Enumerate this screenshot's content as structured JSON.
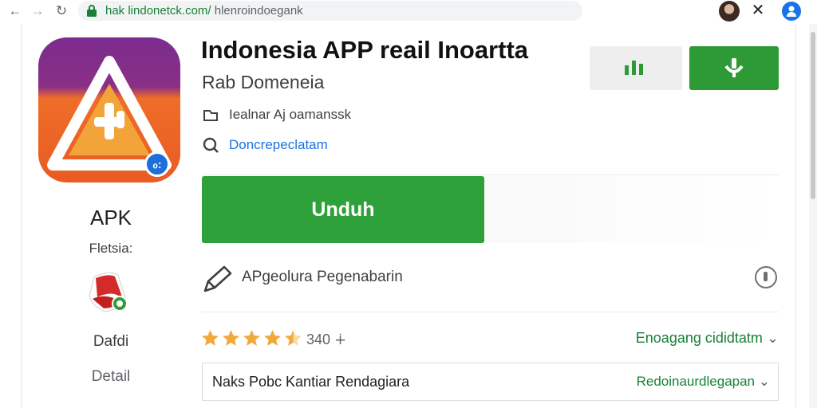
{
  "browser": {
    "back_icon": "arrow-left-icon",
    "forward_icon": "arrow-right-icon",
    "reload_icon": "reload-icon",
    "url_host": "hak lindonetck.com/",
    "url_path": " hlenroindoegank",
    "close_icon": "close-icon",
    "profile_icon": "profile-icon"
  },
  "sidebar": {
    "title": "APK",
    "subtitle": "Fletsia:",
    "link_1": "Dafdi",
    "link_2": "Detail"
  },
  "app": {
    "title": "Indonesia APP reail Inoartta",
    "developer": "Rab Domeneia",
    "meta_1": "Iealnar Aj oamanssk",
    "meta_2": "Doncrepeclatam",
    "badge_text": "ℴ:"
  },
  "actions": {
    "download_label": "Unduh"
  },
  "permissions": {
    "label": "APgeolura Pegenabarin"
  },
  "rating": {
    "stars": 4.5,
    "count_text": "340 ∔",
    "link_text": "Enoagang cididtatm"
  },
  "details": {
    "label": "Naks Pobc Kantiar Rendagiara",
    "link_text": "Redoinaurdlegapan"
  },
  "colors": {
    "primary_green": "#2fa13a",
    "link_blue": "#1a73e8",
    "star_gold": "#f2a93b"
  }
}
